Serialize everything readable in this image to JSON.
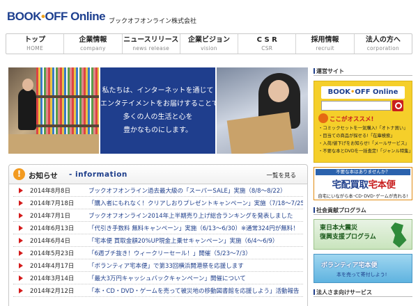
{
  "header": {
    "logo": {
      "part1": "BOOK",
      "dot": "•",
      "part2": "OFF",
      "part3": " Online"
    },
    "company_name": "ブックオフオンライン株式会社"
  },
  "nav": [
    {
      "jp": "トップ",
      "en": "HOME"
    },
    {
      "jp": "企業情報",
      "en": "company"
    },
    {
      "jp": "ニュースリリース",
      "en": "news release"
    },
    {
      "jp": "企業ビジョン",
      "en": "vision"
    },
    {
      "jp": "C S R",
      "en": "CSR"
    },
    {
      "jp": "採用情報",
      "en": "recruit"
    },
    {
      "jp": "法人の方へ",
      "en": "corporation"
    }
  ],
  "hero": {
    "lines": [
      "私たちは、インターネットを通じて",
      "エンタテイメントをお届けすることで",
      "多くの人の生活と心を",
      "豊かなものにします。"
    ]
  },
  "news": {
    "icon_label": "!",
    "title": "お知らせ",
    "subtitle": "- information",
    "all_link": "一覧を見る",
    "items": [
      {
        "date": "2014年8月8日",
        "text": "ブックオフオンライン過去最大級の「スーパーSALE」実施（8/8〜8/22）"
      },
      {
        "date": "2014年7月18日",
        "text": "「購入者にもれなく！クリアしおりプレゼントキャンペーン」実施（7/18〜7/25）"
      },
      {
        "date": "2014年7月1日",
        "text": "ブックオフオンライン2014年上半期売り上げ総合ランキングを発表しました"
      },
      {
        "date": "2014年6月13日",
        "text": "「代引き手数料 無料キャンペーン」実施（6/13〜6/30）※通常324円が無料！"
      },
      {
        "date": "2014年6月4日",
        "text": "「宅本便 買取金額20%UP現金上乗せキャンペーン」実施（6/4〜6/9）"
      },
      {
        "date": "2014年5月23日",
        "text": "「6週ブチ抜き！ウィークリーセール！」開催（5/23〜7/3）"
      },
      {
        "date": "2014年4月17日",
        "text": "「ボランティア宅本便」で第33回横浜開港祭を応援します"
      },
      {
        "date": "2014年3月14日",
        "text": "「最大3万円キャッシュバックキャンペーン」開催について"
      },
      {
        "date": "2014年2月12日",
        "text": "「本・CD・DVD・ゲームを売って被災地の移動図書館を応援しよう」活動報告"
      }
    ]
  },
  "sidebar": {
    "operated_title": "運営サイト",
    "bo_banner": {
      "logo1": "BOOK",
      "dot": "•",
      "logo2": "OFF Online",
      "pick": "ここがオススメ!",
      "lines": [
        "・コミックセットを一気購入!「オトナ買い」",
        "・目当ての商品が探せる!「在庫検索」",
        "・入荷/値下げをお知らせ!「メールサービス」",
        "・不要な本とDVDを一括査定!「ジャンル特集」"
      ]
    },
    "takuhon_banner": {
      "top": "不要な本はありませんか？",
      "main1": "宅配買取",
      "main2": "宅本便",
      "bottom": "自宅にいながら本･CD･DVD･ゲームが売れる!"
    },
    "csr_title": "社会貢献プログラム",
    "fukko_banner": {
      "line1": "東日本大震災",
      "line2": "復興支援プログラム"
    },
    "volunteer_banner": {
      "main": "ボランティア宅本便",
      "sub": "本を売って寄付しよう!"
    },
    "corp_title": "法人さま向けサービス"
  }
}
